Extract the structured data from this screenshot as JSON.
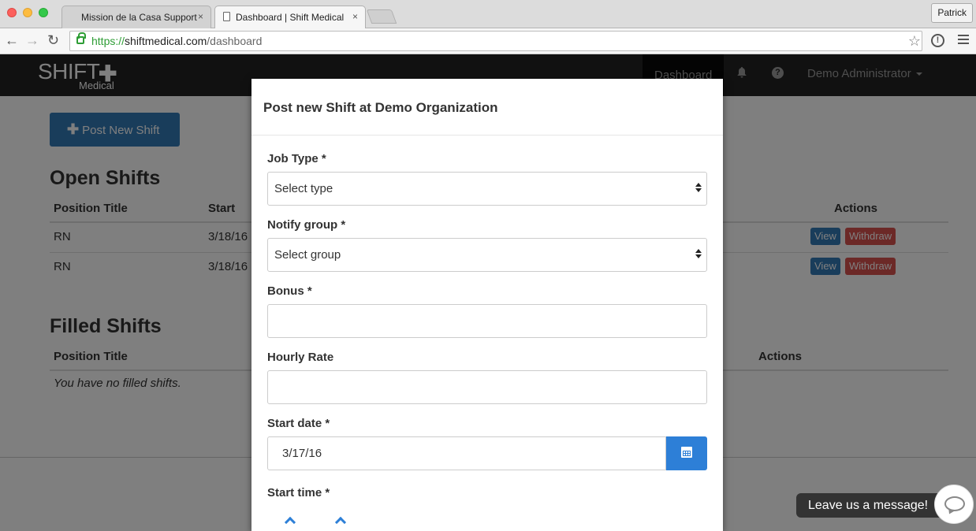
{
  "browser": {
    "tabs": [
      {
        "title": "Mission de la Casa Support",
        "close": "×"
      },
      {
        "title": "Dashboard | Shift Medical",
        "close": "×"
      }
    ],
    "profile": "Patrick",
    "url": {
      "scheme": "https://",
      "host": "shiftmedical.com",
      "path": "/dashboard"
    },
    "icons": {
      "back": "back-arrow-icon",
      "forward": "forward-arrow-icon",
      "reload": "reload-icon",
      "star": "star-icon",
      "info": "info-icon",
      "menu": "menu-icon"
    }
  },
  "navbar": {
    "brand": {
      "name": "SHIFT",
      "plus": "✚",
      "sub": "Medical"
    },
    "dashboard": "Dashboard",
    "user": "Demo Administrator"
  },
  "page": {
    "post_button": "Post New Shift",
    "open_shifts": {
      "title": "Open Shifts",
      "headers": {
        "position": "Position Title",
        "start": "Start",
        "actions": "Actions"
      },
      "rows": [
        {
          "position": "RN",
          "start": "3/18/16",
          "view": "View",
          "withdraw": "Withdraw"
        },
        {
          "position": "RN",
          "start": "3/18/16",
          "view": "View",
          "withdraw": "Withdraw"
        }
      ]
    },
    "filled_shifts": {
      "title": "Filled Shifts",
      "headers": {
        "position": "Position Title",
        "actions": "Actions"
      },
      "empty": "You have no filled shifts."
    }
  },
  "modal": {
    "title": "Post new Shift at Demo Organization",
    "job_type": {
      "label": "Job Type *",
      "value": "Select type"
    },
    "notify_group": {
      "label": "Notify group *",
      "value": "Select group"
    },
    "bonus": {
      "label": "Bonus *",
      "value": ""
    },
    "hourly_rate": {
      "label": "Hourly Rate",
      "value": ""
    },
    "start_date": {
      "label": "Start date *",
      "value": "3/17/16"
    },
    "start_time": {
      "label": "Start time *"
    }
  },
  "chat": {
    "label": "Leave us a message!"
  },
  "colors": {
    "primary": "#337ab7",
    "danger": "#d9534f",
    "navbar": "#222222",
    "calendar_button": "#2d7fd7"
  }
}
